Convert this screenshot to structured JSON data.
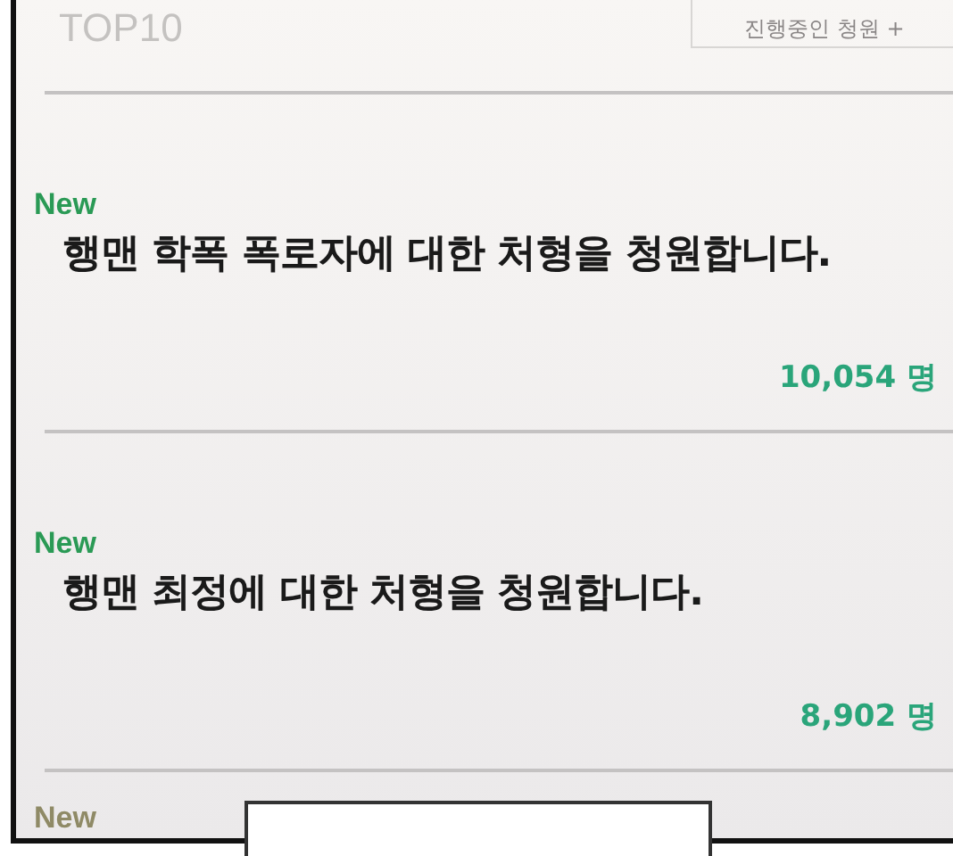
{
  "header": {
    "title": "TOP10",
    "button": "진행중인 청원 +"
  },
  "petitions": [
    {
      "badge": "New",
      "title": "행맨 학폭 폭로자에 대한 처형을 청원합니다.",
      "count": "10,054 명"
    },
    {
      "badge": "New",
      "title": "행맨 최정에 대한 처형을 청원합니다.",
      "count": "8,902 명"
    }
  ],
  "partial_badge": "New"
}
